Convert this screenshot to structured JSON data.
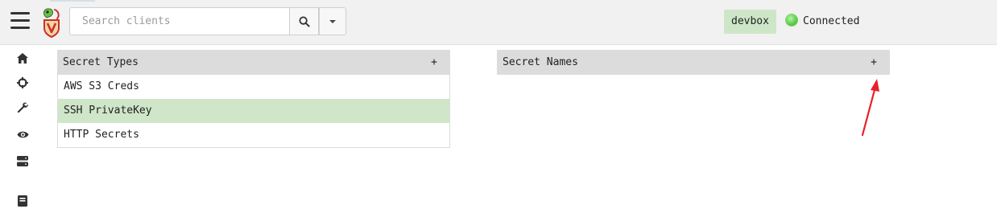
{
  "header": {
    "search_placeholder": "Search clients",
    "environment": "devbox",
    "connection_status": "Connected",
    "connection_color": "#5ed04a",
    "environment_bg": "#cde6c8"
  },
  "sidebar": {
    "icons": [
      "home-icon",
      "crosshair-icon",
      "wrench-icon",
      "eye-icon",
      "server-icon",
      "book-icon"
    ]
  },
  "secret_types": {
    "title": "Secret Types",
    "add_label": "+",
    "items": [
      {
        "label": "AWS S3 Creds",
        "selected": false
      },
      {
        "label": "SSH PrivateKey",
        "selected": true
      },
      {
        "label": "HTTP Secrets",
        "selected": false
      }
    ],
    "selected_color": "#cfe6c9"
  },
  "secret_names": {
    "title": "Secret Names",
    "add_label": "+"
  }
}
